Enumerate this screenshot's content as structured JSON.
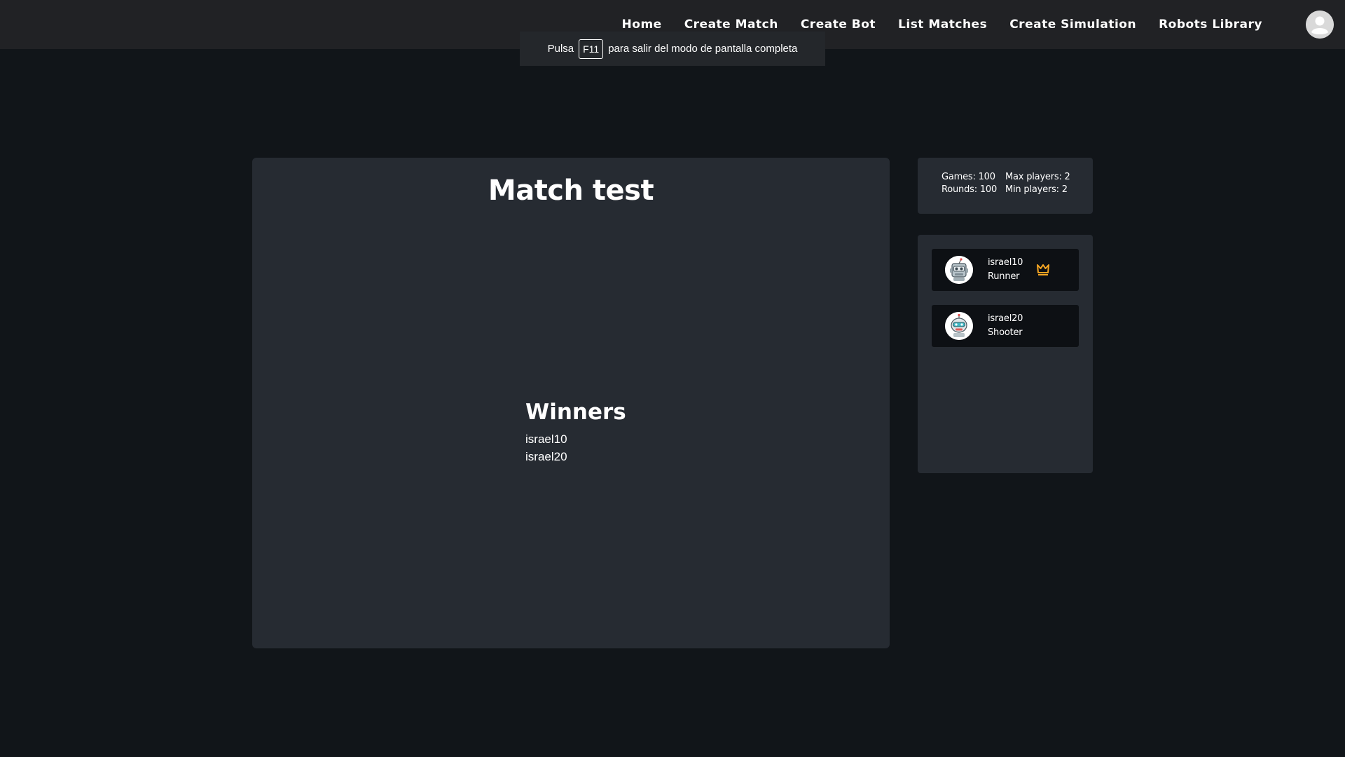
{
  "nav": {
    "items": [
      {
        "label": "Home",
        "name": "nav-home"
      },
      {
        "label": "Create Match",
        "name": "nav-create-match"
      },
      {
        "label": "Create Bot",
        "name": "nav-create-bot"
      },
      {
        "label": "List Matches",
        "name": "nav-list-matches"
      },
      {
        "label": "Create Simulation",
        "name": "nav-create-simulation"
      },
      {
        "label": "Robots Library",
        "name": "nav-robots-library"
      }
    ],
    "avatar_icon": "user-avatar-icon"
  },
  "fullscreen_notice": {
    "prefix": "Pulsa",
    "key": "F11",
    "suffix": "para salir del modo de pantalla completa"
  },
  "match": {
    "title": "Match test",
    "winners_title": "Winners",
    "winners": [
      "israel10",
      "israel20"
    ]
  },
  "stats": {
    "games": "Games: 100",
    "max_players": "Max players: 2",
    "rounds": "Rounds: 100",
    "min_players": "Min players: 2"
  },
  "players": [
    {
      "name": "israel10",
      "role": "Runner",
      "avatar_icon": "robot-avatar-icon",
      "badge_icon": "crown-icon"
    },
    {
      "name": "israel20",
      "role": "Shooter",
      "avatar_icon": "robot-avatar-icon"
    }
  ],
  "colors": {
    "background": "#111519",
    "navbar": "#212225",
    "panel": "#262b32",
    "player_card": "#0d1014",
    "crown": "#f5a623"
  }
}
